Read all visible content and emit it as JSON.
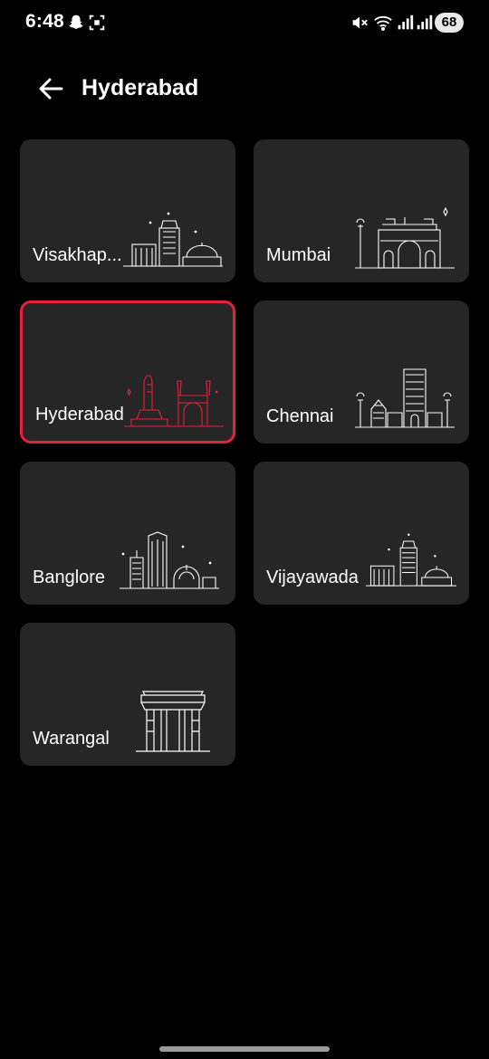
{
  "status_bar": {
    "time": "6:48",
    "battery": "68",
    "icons": [
      "snapchat-icon",
      "screenshot-icon",
      "mute-icon",
      "wifi-icon",
      "signal-icon",
      "signal-icon"
    ]
  },
  "header": {
    "title": "Hyderabad",
    "back_icon": "arrow-left-icon"
  },
  "cities": [
    {
      "name": "Visakhapatnam",
      "display": "Visakhap...",
      "art": "vizag-skyline-icon",
      "selected": false
    },
    {
      "name": "Mumbai",
      "display": "Mumbai",
      "art": "gateway-of-india-icon",
      "selected": false
    },
    {
      "name": "Hyderabad",
      "display": "Hyderabad",
      "art": "charminar-skyline-icon",
      "selected": true
    },
    {
      "name": "Chennai",
      "display": "Chennai",
      "art": "temple-gopuram-icon",
      "selected": false
    },
    {
      "name": "Banglore",
      "display": "Banglore",
      "art": "bangalore-skyline-icon",
      "selected": false
    },
    {
      "name": "Vijayawada",
      "display": "Vijayawada",
      "art": "vijayawada-skyline-icon",
      "selected": false
    },
    {
      "name": "Warangal",
      "display": "Warangal",
      "art": "kakatiya-arch-icon",
      "selected": false
    }
  ],
  "colors": {
    "background": "#000000",
    "card": "#262626",
    "accent": "#e8203a",
    "text": "#ffffff"
  }
}
